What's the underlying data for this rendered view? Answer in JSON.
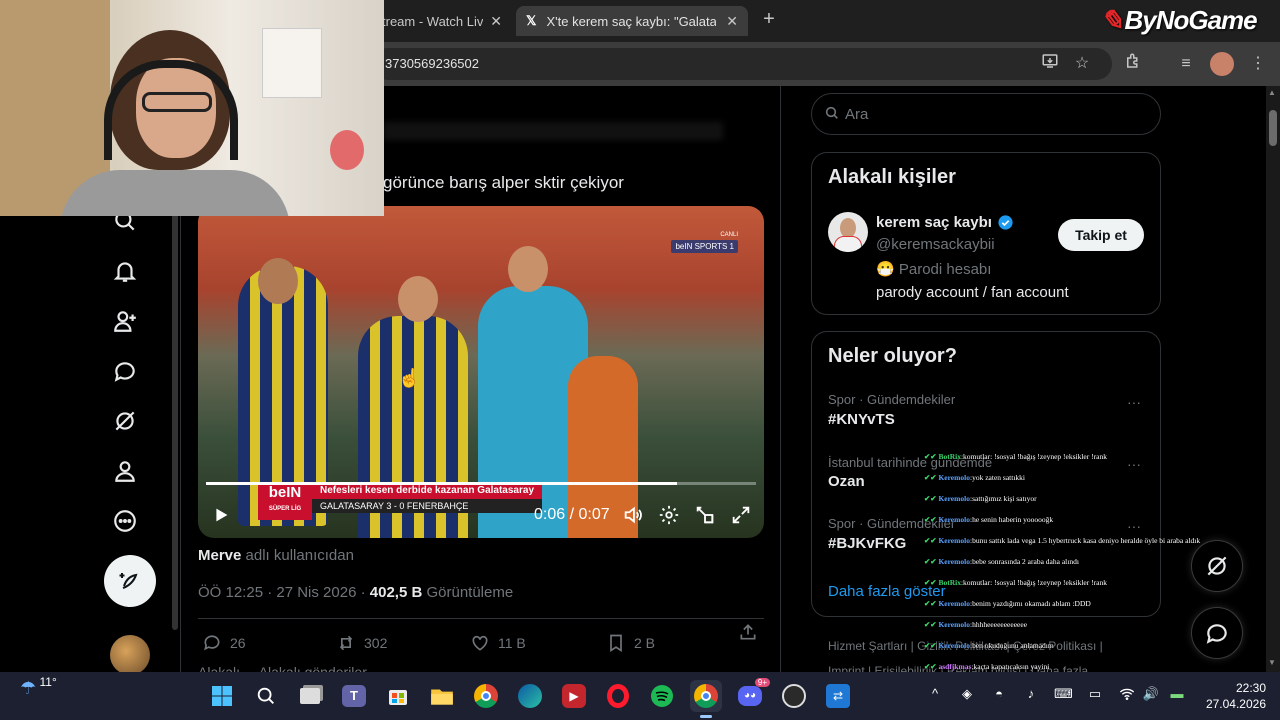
{
  "browser": {
    "tabs": [
      {
        "title": "tream - Watch Liv",
        "active": false
      },
      {
        "title": "X'te kerem saç kaybı: \"Galatasar",
        "active": true
      }
    ],
    "url": "3730569236502"
  },
  "logo": {
    "text": "ByNoGame"
  },
  "tweet": {
    "text": "görünce barış alper sktir çekiyor",
    "video": {
      "channel": "CANLI",
      "channel_logo": "beIN SPORTS 1",
      "ticker_logo": "beIN",
      "ticker_logo_sub": "SÜPER LİG",
      "ticker_title": "Nefesleri kesen derbide kazanan Galatasaray",
      "ticker_sub": "GALATASARAY 3 - 0 FENERBAHÇE",
      "time": "0:06 / 0:07",
      "progress_fraction": 0.857
    },
    "attribution_user": "Merve",
    "attribution_suffix": " adlı kullanıcıdan",
    "time_date": "ÖÖ 12:25 · 27 Nis 2026 · ",
    "views_count": "402,5 B",
    "views_label": " Görüntüleme",
    "actions": {
      "replies": "26",
      "reposts": "302",
      "likes": "11 B",
      "bookmarks": "2 B"
    },
    "next_row": "Alakalı      ...           Alakalı gönderiler"
  },
  "sidebar": {
    "search_placeholder": "Ara",
    "relevant_title": "Alakalı kişiler",
    "person": {
      "name": "kerem saç kaybı",
      "handle": "@keremsackaybii",
      "parody": "Parodi hesabı",
      "bio": "parody account / fan account",
      "follow_label": "Takip et"
    },
    "trends_title": "Neler oluyor?",
    "trends": [
      {
        "category": "Spor · Gündemdekiler",
        "name": "#KNYvTS"
      },
      {
        "category": "İstanbul tarihinde gündemde",
        "name": "Ozan"
      },
      {
        "category": "Spor · Gündemdekiler",
        "name": "#BJKvFKG"
      }
    ],
    "more_icon": "···",
    "show_more": "Daha fazla göster",
    "footer_line1": "Hizmet Şartları  |  Gizlilik Politikası  |  Çerez Politikası  |",
    "footer_line2": "Imprint  |  Erişilebilirlik  |  Reklam bilgisi  |  Daha fazla ..."
  },
  "chat": [
    {
      "user": "BotRix",
      "color": "#3ad36b",
      "msg": "komutlar: !sosyal !bağış !zeynep !eksikler !rank"
    },
    {
      "user": "Keremolo",
      "color": "#5aa0ff",
      "msg": "yok zaten sattıkki"
    },
    {
      "user": "Keremolo",
      "color": "#5aa0ff",
      "msg": "sattığımız kişi satıyor"
    },
    {
      "user": "Keremolo",
      "color": "#5aa0ff",
      "msg": "he senin haberin yoooooğk"
    },
    {
      "user": "Keremolo",
      "color": "#5aa0ff",
      "msg": "bunu sattık lada vega 1.5 hybertruck kasa deniyo heralde öyle bi araba aldık"
    },
    {
      "user": "Keremolo",
      "color": "#5aa0ff",
      "msg": "bebe sonrasında 2 araba daha alındı"
    },
    {
      "user": "BotRix",
      "color": "#3ad36b",
      "msg": "komutlar: !sosyal !bağış !zeynep !eksikler !rank"
    },
    {
      "user": "Keremolo",
      "color": "#5aa0ff",
      "msg": "benim yazdığımı okamadı ablam :DDD"
    },
    {
      "user": "Keremolo",
      "color": "#5aa0ff",
      "msg": "hhhheeeeeeeeeeee"
    },
    {
      "user": "Keremolo",
      "color": "#5aa0ff",
      "msg": "ben okuduğunu anlamadım"
    },
    {
      "user": "asdfjkmas",
      "color": "#d07cff",
      "msg": "kaçta kapatıcaksın yayini"
    },
    {
      "user": "asdfjkmas",
      "color": "#d07cff",
      "msg": "kiyamam anneın"
    },
    {
      "user": "BotRix",
      "color": "#3ad36b",
      "msg": "komutlar: !sosyal !bağış !zeynep !eksikler !rank"
    }
  ],
  "taskbar": {
    "weather_temp": "11°",
    "time": "22:30",
    "date": "27.04.2026",
    "discord_badge": "9+",
    "apps": [
      "start-icon",
      "search-icon",
      "file-viewer-icon",
      "teams-icon",
      "store-icon",
      "explorer-icon",
      "chrome-icon",
      "edge-icon",
      "media-icon",
      "opera-icon",
      "spotify-icon",
      "chrome-active-icon",
      "discord-icon",
      "obs-icon",
      "remote-icon"
    ]
  }
}
